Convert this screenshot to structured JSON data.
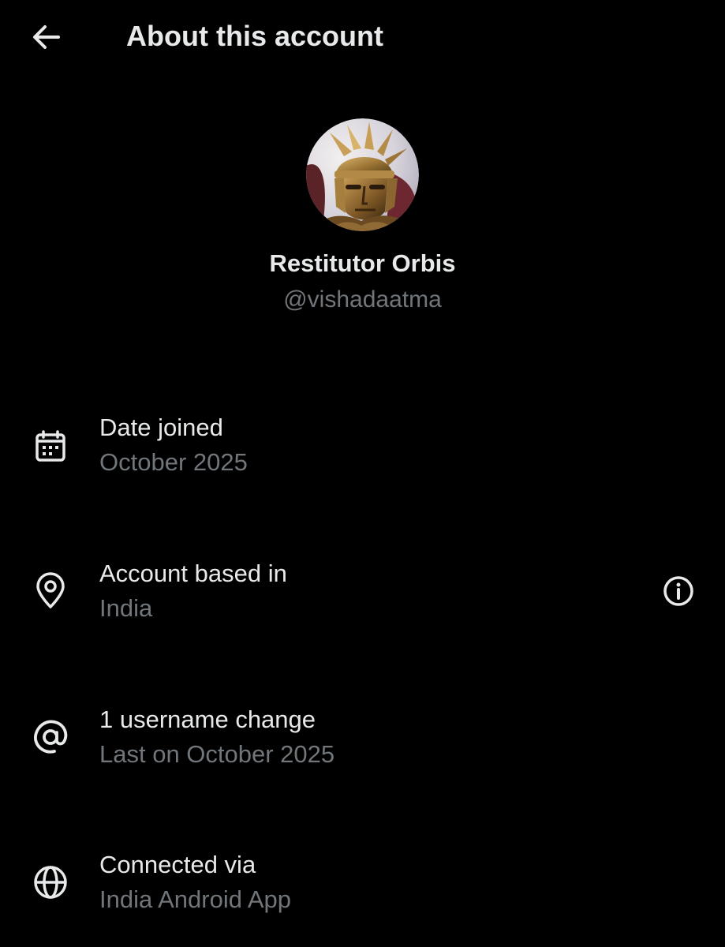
{
  "header": {
    "title": "About this account",
    "back_icon": "arrow-left-icon"
  },
  "profile": {
    "display_name": "Restitutor Orbis",
    "handle": "@vishadaatma",
    "avatar_description_icon": "avatar-image"
  },
  "rows": [
    {
      "icon": "calendar-icon",
      "title": "Date joined",
      "value": "October 2025"
    },
    {
      "icon": "location-pin-icon",
      "title": "Account based in",
      "value": "India",
      "trailing_icon": "info-icon"
    },
    {
      "icon": "at-sign-icon",
      "title": "1 username change",
      "value": "Last on October 2025"
    },
    {
      "icon": "globe-icon",
      "title": "Connected via",
      "value": "India Android App"
    }
  ],
  "colors": {
    "background": "#000000",
    "primary_text": "#e7e9ea",
    "secondary_text": "#71767b"
  }
}
